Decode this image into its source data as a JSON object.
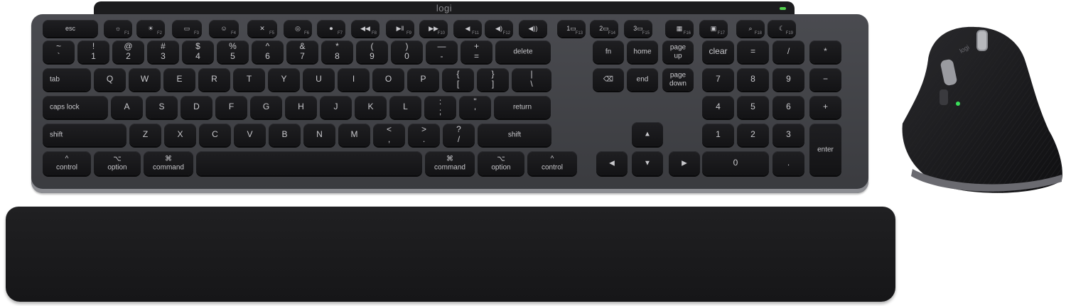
{
  "logo_text": "logi",
  "keyboard": {
    "function_row": [
      {
        "name": "esc",
        "main": "esc",
        "sub": ""
      },
      {
        "name": "f1-brightness-down",
        "main": "☼",
        "sub": "F1"
      },
      {
        "name": "f2-brightness-up",
        "main": "☀",
        "sub": "F2"
      },
      {
        "name": "f3-mission-control",
        "main": "▭",
        "sub": "F3"
      },
      {
        "name": "f4-emoji",
        "main": "☺",
        "sub": "F4"
      },
      {
        "name": "f5-mute-mic",
        "main": "✕",
        "sub": "F5"
      },
      {
        "name": "f6-screenshot",
        "main": "◎",
        "sub": "F6"
      },
      {
        "name": "f7-dictation",
        "main": "⏺",
        "sub": "F7"
      },
      {
        "name": "f8-rewind",
        "main": "◀◀",
        "sub": "F8"
      },
      {
        "name": "f9-play-pause",
        "main": "▶‖",
        "sub": "F9"
      },
      {
        "name": "f10-forward",
        "main": "▶▶",
        "sub": "F10"
      },
      {
        "name": "f11-mute",
        "main": "◀",
        "sub": "F11"
      },
      {
        "name": "f12-volume-down",
        "main": "◀)",
        "sub": "F12"
      },
      {
        "name": "volume-up-lock",
        "main": "◀))",
        "sub": ""
      },
      {
        "name": "easy-switch-1",
        "main": "1▭",
        "sub": "F13"
      },
      {
        "name": "easy-switch-2",
        "main": "2▭",
        "sub": "F14"
      },
      {
        "name": "easy-switch-3",
        "main": "3▭",
        "sub": "F15"
      },
      {
        "name": "f16-calculator",
        "main": "▦",
        "sub": "F16"
      },
      {
        "name": "f17-screen-lock",
        "main": "▣",
        "sub": "F17"
      },
      {
        "name": "f18-search",
        "main": "⌕",
        "sub": "F18"
      },
      {
        "name": "f19-sleep",
        "main": "☾",
        "sub": "F19"
      }
    ],
    "number_row": [
      "~\n`",
      "!\n1",
      "@\n2",
      "#\n3",
      "$\n4",
      "%\n5",
      "^\n6",
      "&\n7",
      "*\n8",
      "(\n9",
      ")\n0",
      "—\n-",
      "+\n=",
      "delete"
    ],
    "q_row": [
      "tab",
      "Q",
      "W",
      "E",
      "R",
      "T",
      "Y",
      "U",
      "I",
      "O",
      "P",
      "{\n[",
      "}\n]",
      "|\n\\"
    ],
    "a_row": [
      "caps lock",
      "A",
      "S",
      "D",
      "F",
      "G",
      "H",
      "J",
      "K",
      "L",
      ":\n;",
      "\"\n'",
      "return"
    ],
    "z_row": [
      "shift",
      "Z",
      "X",
      "C",
      "V",
      "B",
      "N",
      "M",
      "<\n,",
      ">\n.",
      "?\n/",
      "shift"
    ],
    "bottom_row": [
      "^\ncontrol",
      "⌥\noption",
      "⌘\ncommand",
      "",
      "⌘\ncommand",
      "⌥\noption",
      "^\ncontrol"
    ],
    "nav_block": [
      "fn",
      "home",
      "page\nup",
      "⌫",
      "end",
      "page\ndown"
    ],
    "arrows": [
      "▲",
      "◀",
      "▼",
      "▶"
    ],
    "numpad": [
      "clear",
      "=",
      "/",
      "*",
      "7",
      "8",
      "9",
      "−",
      "4",
      "5",
      "6",
      "+",
      "1",
      "2",
      "3",
      "enter",
      "0",
      "."
    ]
  },
  "mouse": {
    "text": "logi"
  }
}
